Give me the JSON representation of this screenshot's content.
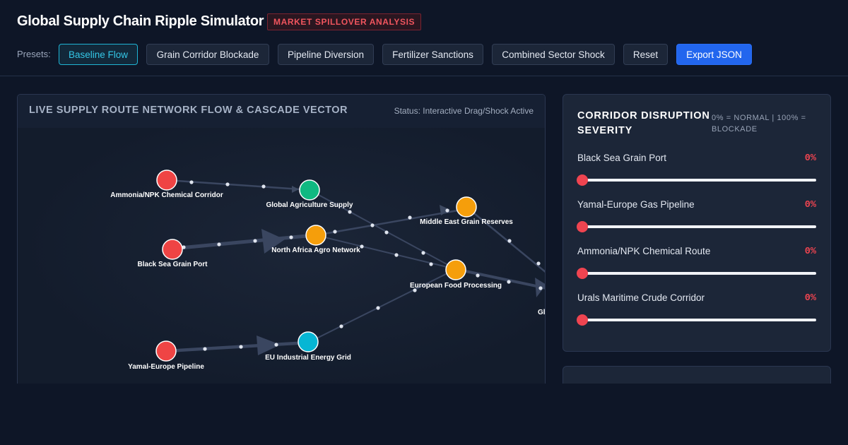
{
  "header": {
    "title": "Global Supply Chain Ripple Simulator",
    "badge": "MARKET SPILLOVER ANALYSIS",
    "presets_label": "Presets:",
    "presets": [
      "Baseline Flow",
      "Grain Corridor Blockade",
      "Pipeline Diversion",
      "Fertilizer Sanctions",
      "Combined Sector Shock"
    ],
    "reset_label": "Reset",
    "export_label": "Export JSON"
  },
  "network": {
    "title": "LIVE SUPPLY ROUTE NETWORK FLOW & CASCADE VECTOR",
    "status": "Status: Interactive Drag/Shock Active",
    "nodes": [
      {
        "id": "ammonia",
        "label": "Ammonia/NPK Chemical Corridor",
        "color": "#ef4444"
      },
      {
        "id": "agri",
        "label": "Global Agriculture Supply",
        "color": "#10b981"
      },
      {
        "id": "blacksea",
        "label": "Black Sea Grain Port",
        "color": "#ef4444"
      },
      {
        "id": "nafrica",
        "label": "North Africa Agro Network",
        "color": "#f59e0b"
      },
      {
        "id": "meast",
        "label": "Middle East Grain Reserves",
        "color": "#f59e0b"
      },
      {
        "id": "eufood",
        "label": "European Food Processing",
        "color": "#f59e0b"
      },
      {
        "id": "yamal",
        "label": "Yamal-Europe Pipeline",
        "color": "#ef4444"
      },
      {
        "id": "euenergy",
        "label": "EU Industrial Energy Grid",
        "color": "#06b6d4"
      },
      {
        "id": "gl",
        "label": "Gl",
        "color": "#f59e0b"
      }
    ]
  },
  "disruption": {
    "title": "CORRIDOR DISRUPTION SEVERITY",
    "hint": "0% = NORMAL | 100% = BLOCKADE",
    "sliders": [
      {
        "label": "Black Sea Grain Port",
        "value": "0%",
        "level": 0
      },
      {
        "label": "Yamal-Europe Gas Pipeline",
        "value": "0%",
        "level": 0
      },
      {
        "label": "Ammonia/NPK Chemical Route",
        "value": "0%",
        "level": 0
      },
      {
        "label": "Urals Maritime Crude Corridor",
        "value": "0%",
        "level": 0
      }
    ]
  }
}
